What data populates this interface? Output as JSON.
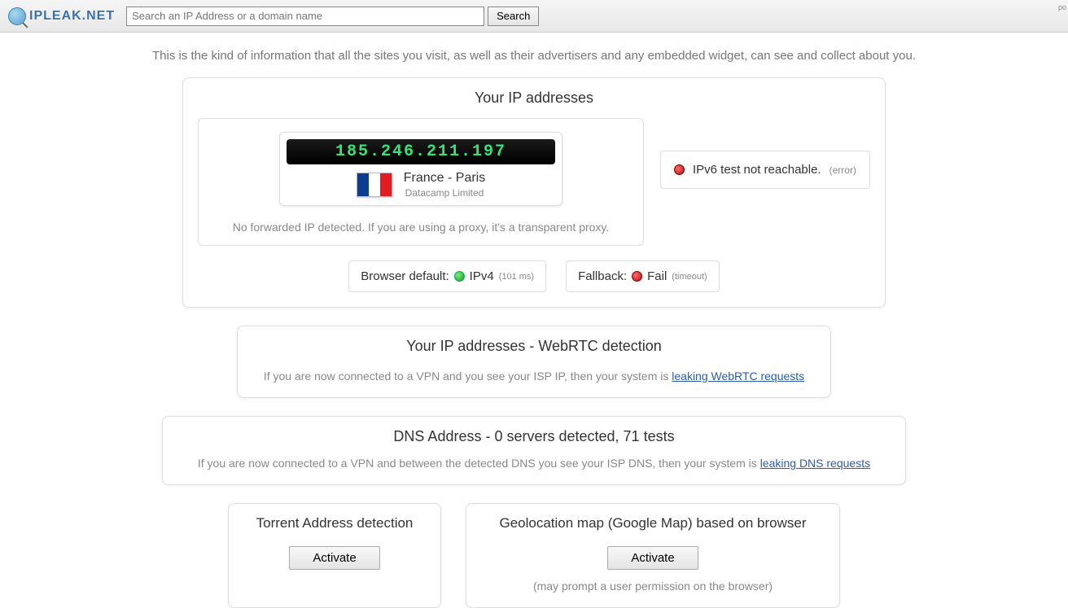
{
  "header": {
    "logo_text": "IPLEAK.NET",
    "search_placeholder": "Search an IP Address or a domain name",
    "search_button": "Search",
    "corner": "po"
  },
  "intro": "This is the kind of information that all the sites you visit, as well as their advertisers and any embedded widget, can see and collect about you.",
  "ip_panel": {
    "title": "Your IP addresses",
    "ip": "185.246.211.197",
    "location": "France - Paris",
    "isp": "Datacamp Limited",
    "forward_note": "No forwarded IP detected. If you are using a proxy, it's a transparent proxy.",
    "ipv6_text": "IPv6 test not reachable.",
    "ipv6_detail": "(error)",
    "browser_default_label": "Browser default:",
    "browser_default_val": "IPv4",
    "browser_default_detail": "(101 ms)",
    "fallback_label": "Fallback:",
    "fallback_val": "Fail",
    "fallback_detail": "(timeout)"
  },
  "webrtc_panel": {
    "title": "Your IP addresses - WebRTC detection",
    "note_prefix": "If you are now connected to a VPN and you see your ISP IP, then your system is ",
    "note_link": "leaking WebRTC requests"
  },
  "dns_panel": {
    "title": "DNS Address - 0 servers detected, 71 tests",
    "note_prefix": "If you are now connected to a VPN and between the detected DNS you see your ISP DNS, then your system is ",
    "note_link": "leaking DNS requests"
  },
  "torrent_panel": {
    "title": "Torrent Address detection",
    "button": "Activate"
  },
  "geo_panel": {
    "title": "Geolocation map (Google Map) based on browser",
    "button": "Activate",
    "note": "(may prompt a user permission on the browser)"
  }
}
